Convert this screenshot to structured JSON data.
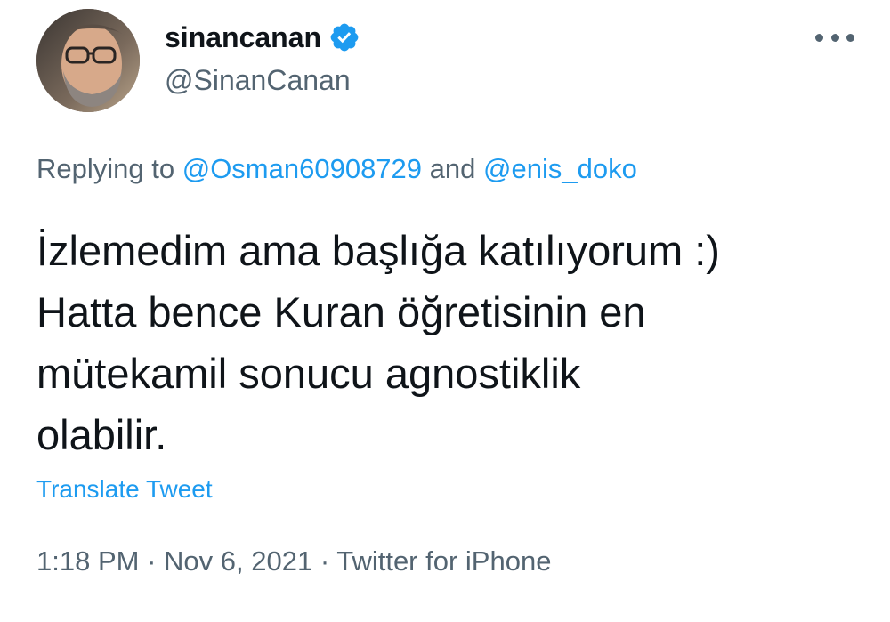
{
  "user": {
    "display_name": "sinancanan",
    "handle": "@SinanCanan",
    "verified": true,
    "verified_color": "#1d9bf0"
  },
  "reply": {
    "prefix": "Replying to",
    "mention_1": "@Osman60908729",
    "conjunction": "and",
    "mention_2": "@enis_doko"
  },
  "tweet": {
    "lines": [
      "İzlemedim ama başlığa katılıyorum :)",
      "Hatta bence Kuran öğretisinin en",
      "mütekamil sonucu agnostiklik",
      "olabilir."
    ],
    "translate_label": "Translate Tweet"
  },
  "meta": {
    "time": "1:18 PM",
    "separator": "·",
    "date": "Nov 6, 2021",
    "source": "Twitter for iPhone"
  },
  "icons": {
    "more": "more-options-icon",
    "verified": "verified-badge-icon"
  },
  "colors": {
    "link": "#1d9bf0",
    "secondary_text": "#536471",
    "primary_text": "#0f1419"
  }
}
